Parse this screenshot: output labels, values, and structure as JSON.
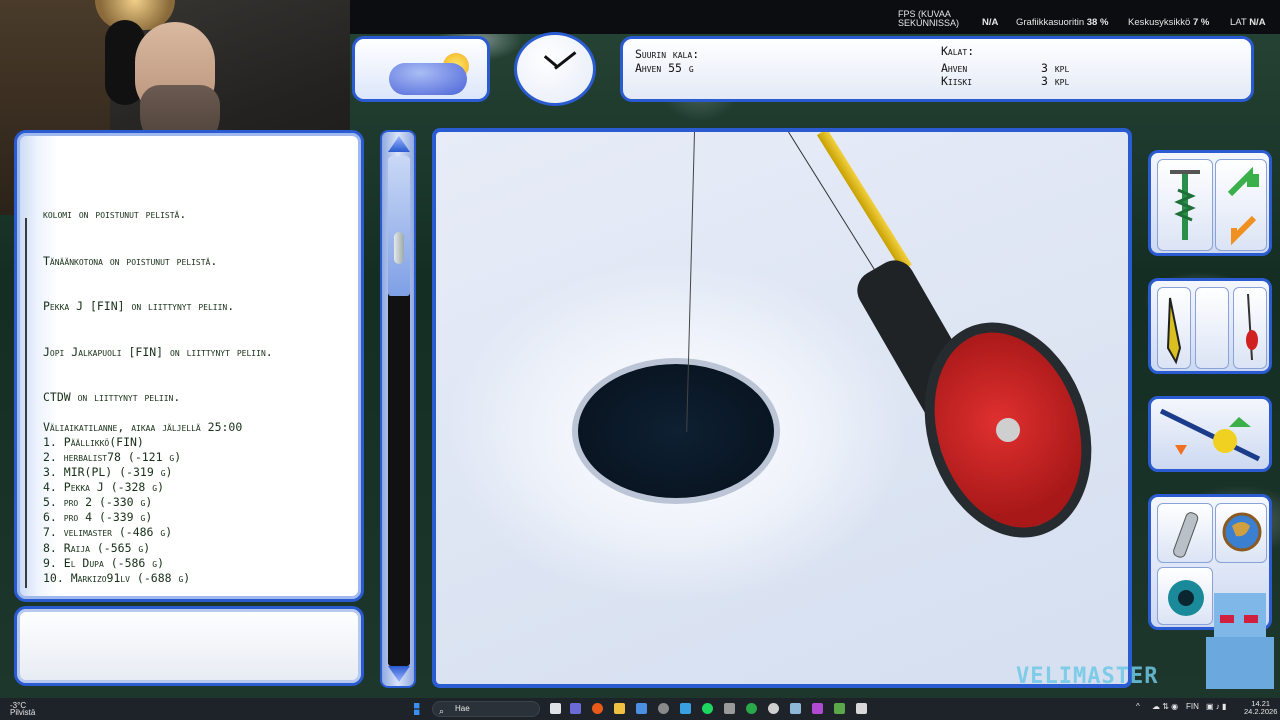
{
  "topbar": {
    "fps_label": "FPS (KUVAA SEKUNNISSA)",
    "fps_value": "N/A",
    "gpu_label": "Grafiikkasuoritin",
    "gpu_value": "38 %",
    "cpu_label": "Keskusyksikkö",
    "cpu_value": "7 %",
    "lat_label": "LAT",
    "lat_value": "N/A"
  },
  "catch_panel": {
    "biggest_label": "Suurin kala:",
    "biggest_value": "Ahven 55 g",
    "fish_label": "Kalat:",
    "fish": [
      {
        "name": "Ahven",
        "count": "3 kpl"
      },
      {
        "name": "Kiiski",
        "count": "3 kpl"
      }
    ]
  },
  "chat": {
    "lines": [
      "kolomi on poistunut pelistä.",
      "Tänäänkotona on poistunut pelistä.",
      "Pekka J [FIN] on liittynyt peliin.",
      "Jopi Jalkapuoli [FIN] on liittynyt peliin.",
      "CTDW on liittynyt peliin.",
      "Väliaikatilanne, aikaa jäljellä 25:00",
      "1. Päällikkö(FIN)",
      "2. herbalist78 (-121 g)",
      "3. MIR(PL) (-319 g)",
      "4. Pekka J (-328 g)",
      "5. pro 2 (-330 g)",
      "6. pro 4 (-339 g)",
      "7. velimaster (-486 g)",
      "8. Raija (-565 g)",
      "9. El Dupa (-586 g)",
      "10. Markizo91lv (-688 g)"
    ],
    "input_value": ""
  },
  "watermark": "VELIMASTER",
  "taskbar": {
    "weather_temp": "-3°C",
    "weather_desc": "Pilvistä",
    "search_placeholder": "Hae",
    "lang": "FIN",
    "time": "14.21",
    "date": "24.2.2026"
  },
  "colors": {
    "frame_blue": "#2a5bd0",
    "chat_text": "#183018",
    "reel_red": "#c82020",
    "rod_yellow": "#e8c020"
  },
  "icons": [
    "weather-partly-cloudy-icon",
    "clock-icon",
    "ice-auger-icon",
    "swap-arrows-icon",
    "lure-icon",
    "jig-rod-icon",
    "rod-settings-icon",
    "flashlight-icon",
    "globe-icon",
    "sonar-eye-icon"
  ]
}
